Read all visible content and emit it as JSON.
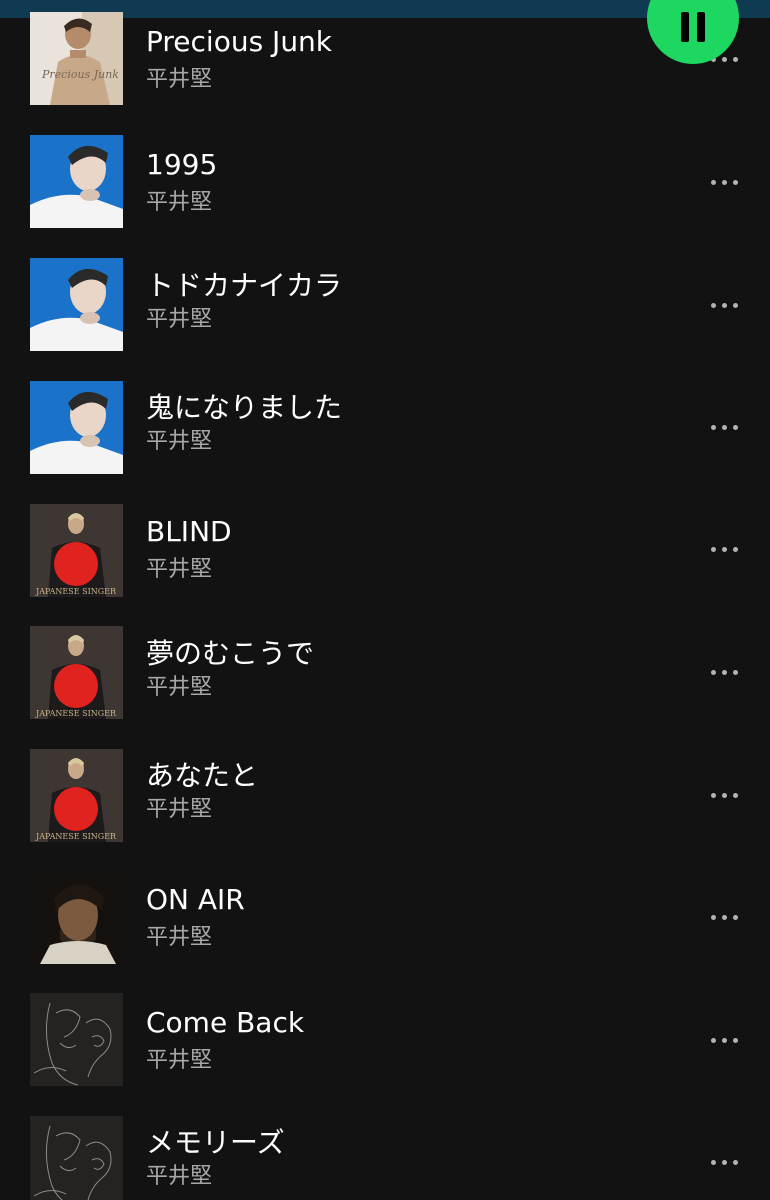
{
  "tracks": [
    {
      "title": "Precious Junk",
      "artist": "平井堅",
      "cover": "precious-junk-cover"
    },
    {
      "title": "1995",
      "artist": "平井堅",
      "cover": "blue-portrait-cover"
    },
    {
      "title": "トドカナイカラ",
      "artist": "平井堅",
      "cover": "blue-portrait-cover"
    },
    {
      "title": "鬼になりました",
      "artist": "平井堅",
      "cover": "blue-portrait-cover"
    },
    {
      "title": "BLIND",
      "artist": "平井堅",
      "cover": "japanese-singer-cover"
    },
    {
      "title": "夢のむこうで",
      "artist": "平井堅",
      "cover": "japanese-singer-cover"
    },
    {
      "title": "あなたと",
      "artist": "平井堅",
      "cover": "japanese-singer-cover"
    },
    {
      "title": "ON AIR",
      "artist": "平井堅",
      "cover": "on-air-cover"
    },
    {
      "title": "Come Back",
      "artist": "平井堅",
      "cover": "sketch-cover"
    },
    {
      "title": "メモリーズ",
      "artist": "平井堅",
      "cover": "sketch-cover"
    }
  ],
  "covers": {
    "precious_junk_text": "Precious Junk",
    "japanese_singer_text": "JAPANESE SINGER"
  },
  "player": {
    "state_icon": "pause-icon",
    "accent": "#1ed760"
  },
  "colors": {
    "background": "#121212",
    "title": "#ffffff",
    "subtitle": "#a7a7a7"
  }
}
